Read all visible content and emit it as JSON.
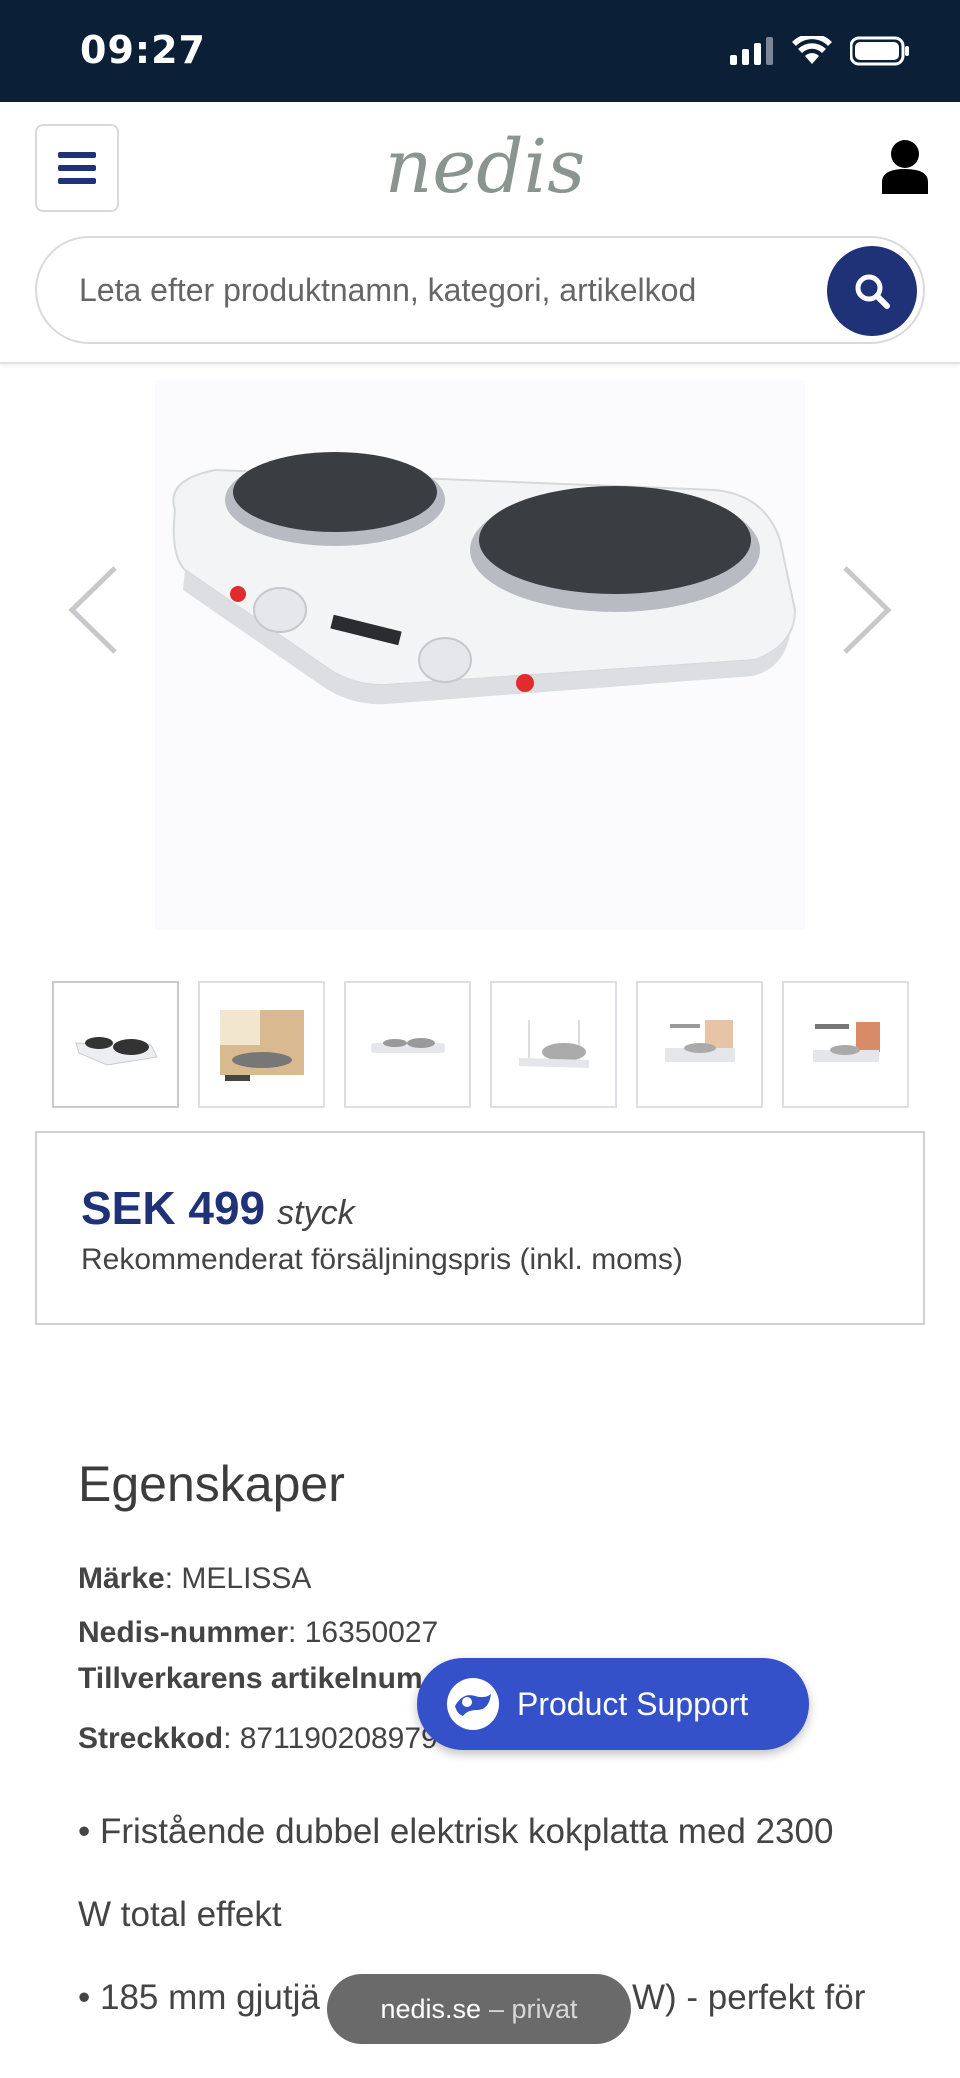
{
  "status_bar": {
    "time": "09:27"
  },
  "header": {
    "logo_text": "nedis",
    "search_placeholder": "Leta efter produktnamn, kategori, artikelkod"
  },
  "price": {
    "value": "SEK 499",
    "unit": "styck",
    "note": "Rekommenderat försäljningspris (inkl. moms)"
  },
  "properties": {
    "title": "Egenskaper",
    "items": [
      {
        "label": "Märke",
        "value": ": MELISSA"
      },
      {
        "label": "Nedis-nummer",
        "value": ": 16350027"
      },
      {
        "label": "Tillverkarens artikelnum",
        "value": ""
      },
      {
        "label": "Streckkod",
        "value": ": 871190208979"
      }
    ],
    "features": [
      "• Fristående dubbel elektrisk kokplatta med 2300",
      "W total effekt",
      "• 185 mm gjutjä",
      "W) - perfekt för"
    ]
  },
  "support_button": {
    "label": "Product Support"
  },
  "browser_pill": {
    "domain": "nedis.se",
    "mode": "– privat"
  },
  "colors": {
    "brand_navy": "#1f3177",
    "support_blue": "#3451c9",
    "status_bar": "#0b1f36",
    "logo_gray": "#8b9590"
  },
  "thumbnails": [
    "thumb-1",
    "thumb-2",
    "thumb-3",
    "thumb-4",
    "thumb-5",
    "thumb-6"
  ]
}
